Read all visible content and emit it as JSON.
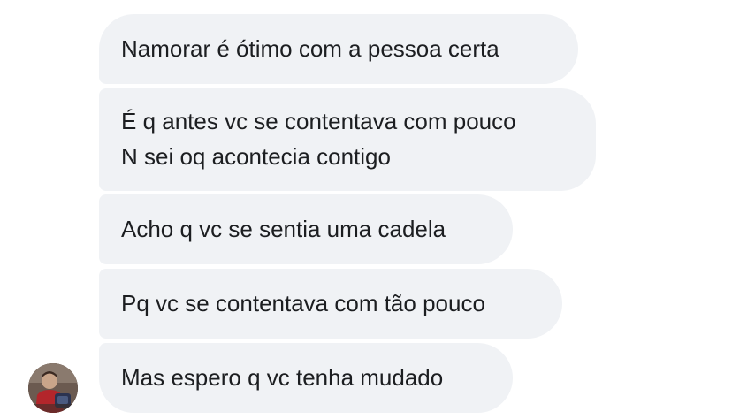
{
  "conversation": {
    "messages": [
      {
        "lines": [
          "Namorar é ótimo com a pessoa certa"
        ]
      },
      {
        "lines": [
          "É q antes vc se contentava com pouco",
          "N sei oq acontecia contigo"
        ]
      },
      {
        "lines": [
          "Acho q vc se sentia uma cadela"
        ]
      },
      {
        "lines": [
          "Pq vc se contentava com tão pouco"
        ]
      },
      {
        "lines": [
          "Mas espero q vc tenha mudado"
        ]
      }
    ],
    "sender_avatar_icon": "user-avatar-photo"
  },
  "colors": {
    "bubble_background": "#f0f2f5",
    "text": "#1c1e21",
    "page_background": "#ffffff"
  }
}
